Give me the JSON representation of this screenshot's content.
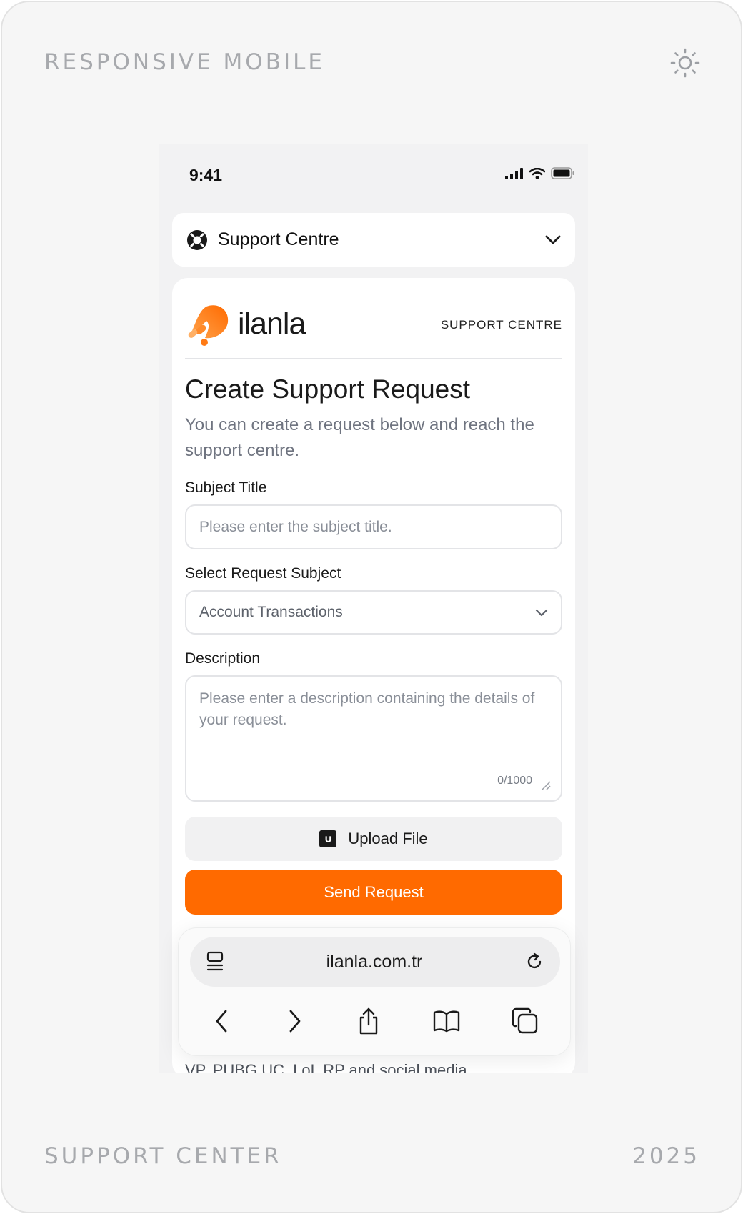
{
  "frame": {
    "top_left_label": "RESPONSIVE MOBILE",
    "bottom_left_label": "SUPPORT CENTER",
    "bottom_right_label": "2025",
    "theme_icon": "sun-icon"
  },
  "status_bar": {
    "time": "9:41"
  },
  "support_selector": {
    "label": "Support Centre"
  },
  "brand": {
    "name": "ilanla",
    "tag": "SUPPORT CENTRE",
    "accent": "#ff6a00"
  },
  "form": {
    "title": "Create Support Request",
    "subtitle": "You can create a request below and reach the support centre.",
    "subject_label": "Subject Title",
    "subject_placeholder": "Please enter the subject title.",
    "request_label": "Select Request Subject",
    "request_value": "Account Transactions",
    "description_label": "Description",
    "description_placeholder": "Please enter a description containing the details of your request.",
    "counter": "0/1000",
    "upload_label": "Upload File",
    "send_label": "Send Request"
  },
  "peek_text": "VP, PUBG UC, LoL RP and social media",
  "browser": {
    "url": "ilanla.com.tr"
  }
}
